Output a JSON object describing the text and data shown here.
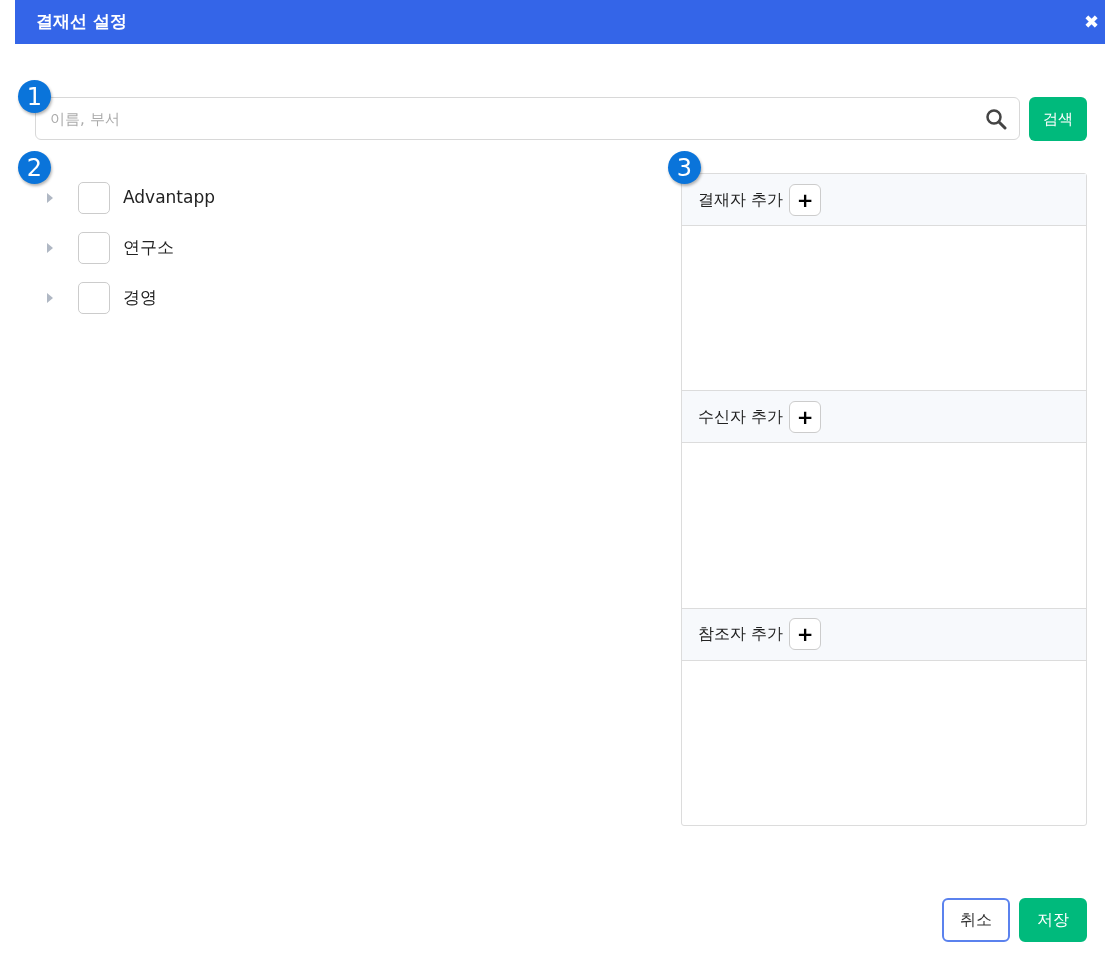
{
  "window": {
    "title": "결재선 설정",
    "close": "✖"
  },
  "search": {
    "placeholder": "이름, 부서",
    "button": "검색"
  },
  "callouts": [
    "1",
    "2",
    "3"
  ],
  "tree": [
    {
      "label": "Advantapp",
      "checked": false,
      "expanded": false
    },
    {
      "label": "연구소",
      "checked": false,
      "expanded": false
    },
    {
      "label": "경영",
      "checked": false,
      "expanded": false
    }
  ],
  "sections": [
    {
      "title": "결재자 추가",
      "add": "+"
    },
    {
      "title": "수신자 추가",
      "add": "+"
    },
    {
      "title": "참조자 추가",
      "add": "+"
    }
  ],
  "buttons": [
    {
      "label": "취소",
      "kind": "outline"
    },
    {
      "label": "저장",
      "kind": "primary"
    }
  ]
}
